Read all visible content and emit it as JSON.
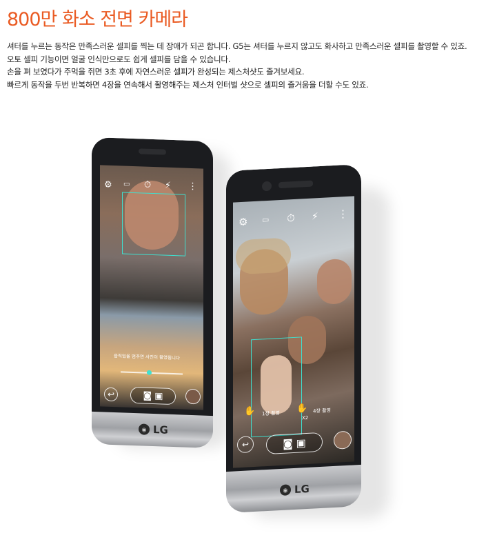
{
  "heading": "800만 화소 전면 카메라",
  "description": [
    "셔터를 누르는 동작은 만족스러운 셀피를 찍는 데 장애가 되곤 합니다. G5는 셔터를 누르지 않고도 화사하고 만족스러운 셀피를 촬영할 수 있죠.",
    "오토 셀피 기능이면 얼굴 인식만으로도 쉽게 셀피를 담을 수 있습니다.",
    "손을 펴 보였다가 주먹을 쥐면 3초 후에 자연스러운 셀피가 완성되는 제스처샷도 즐겨보세요.",
    "빠르게 동작을 두번 반복하면 4장을 연속해서 촬영해주는 제스처 인터벌 샷으로 셀피의 즐거움을 더할 수도 있죠."
  ],
  "phone_left": {
    "brand": "LG",
    "screen_hint": "움직임을 멈추면 사진이 촬영됩니다"
  },
  "phone_right": {
    "brand": "LG",
    "gesture_labels": [
      "1장 촬영",
      "4장 촬영"
    ],
    "burst_label": "X2"
  },
  "icons": {
    "settings": "gear-icon",
    "camera": "camera-icon",
    "video": "video-icon",
    "back": "back-icon",
    "flash": "flash-off-icon",
    "more": "more-icon"
  },
  "colors": {
    "heading": "#ea5b23",
    "focus_frame": "#3fe0d0"
  }
}
